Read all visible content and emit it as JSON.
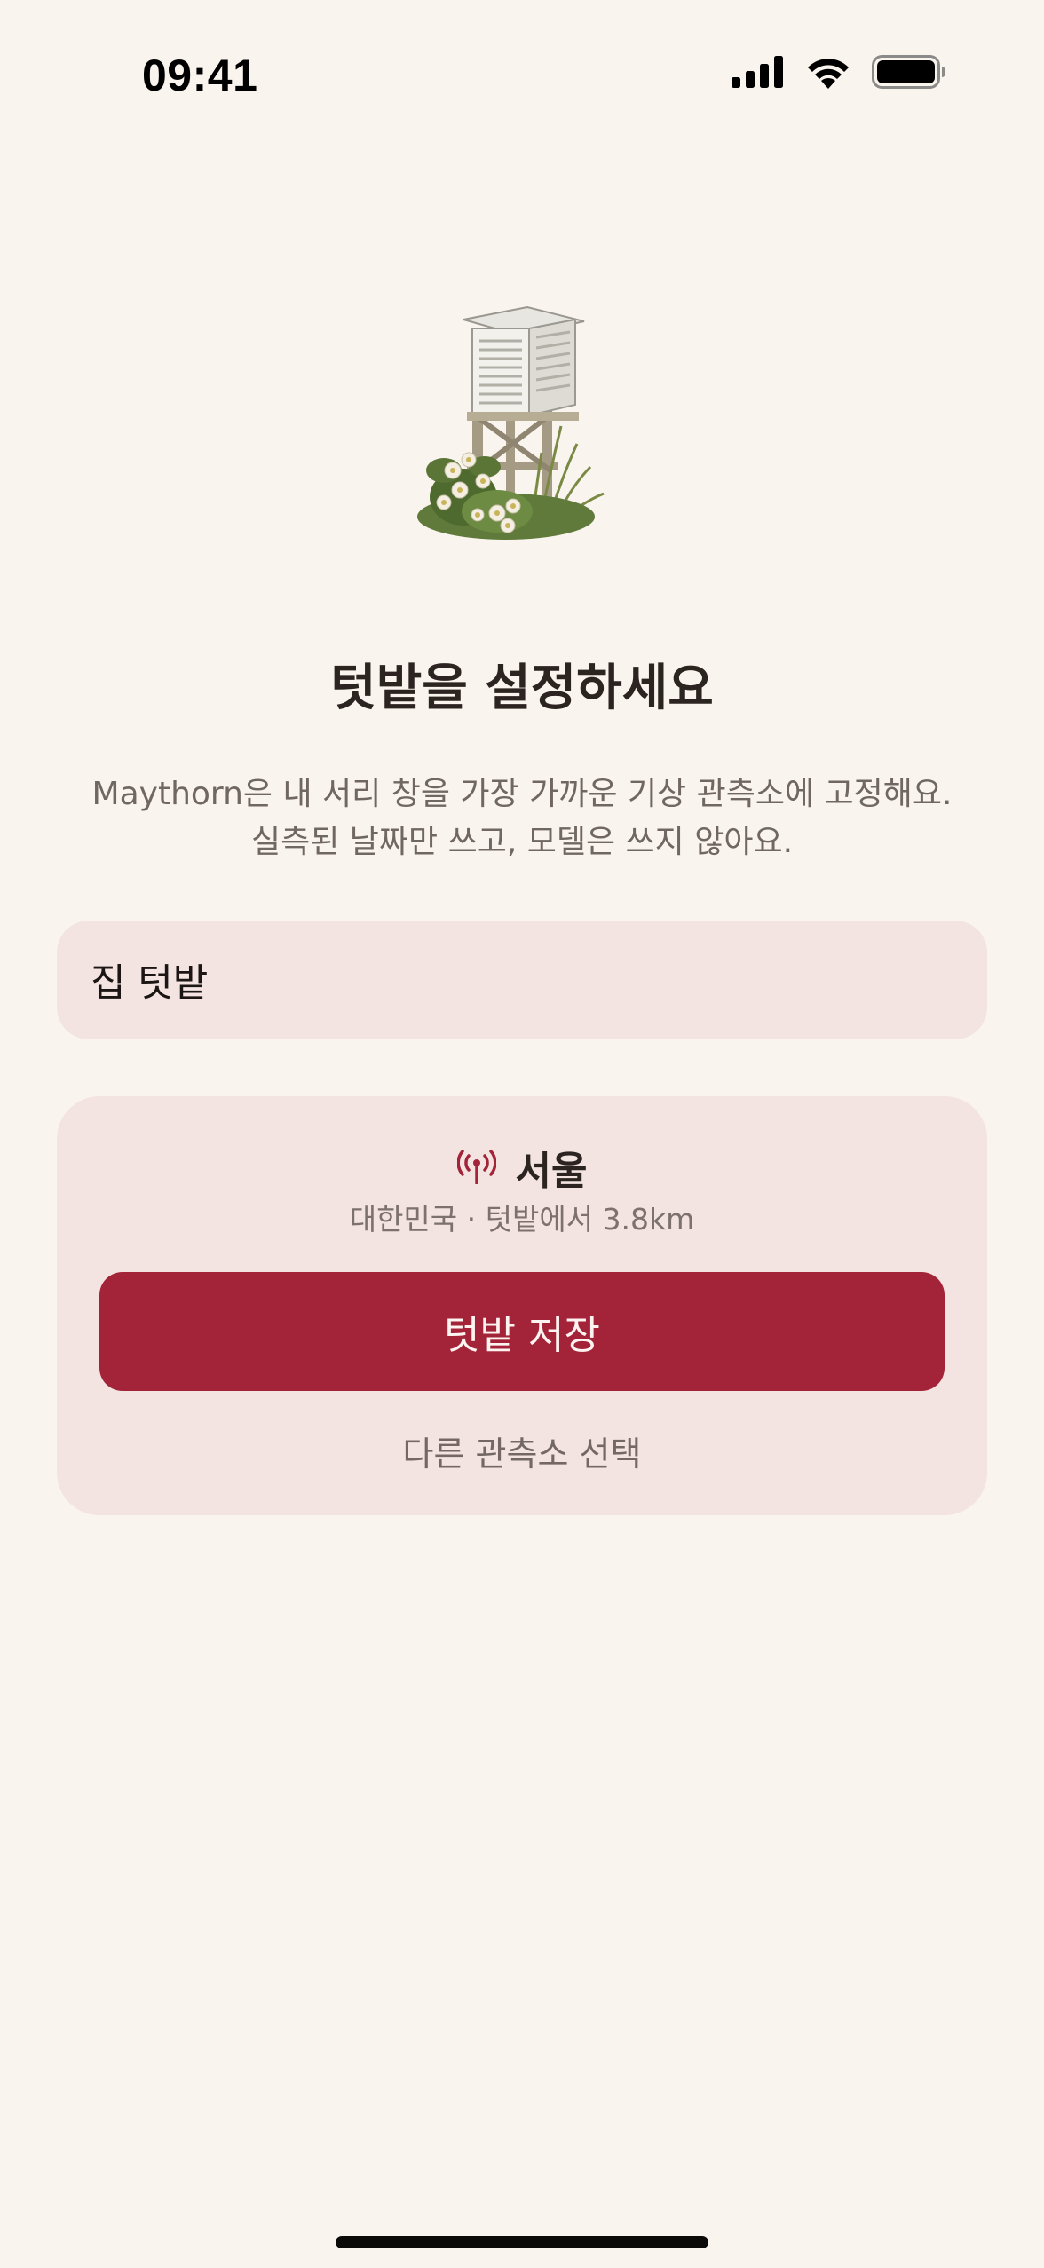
{
  "status_bar": {
    "time": "09:41"
  },
  "illustration": {
    "icon": "weather-station-shelter-illustration"
  },
  "title": "텃밭을 설정하세요",
  "subtitle": {
    "line1": "Maythorn은 내 서리 창을 가장 가까운 기상 관측소에 고정해요.",
    "line2": "실측된 날짜만 쓰고, 모델은 쓰지 않아요."
  },
  "name_field": {
    "value": "집 텃밭"
  },
  "station_card": {
    "icon": "antenna-icon",
    "station_name": "서울",
    "station_meta": "대한민국 · 텃밭에서 3.8km",
    "save_label": "텃밭 저장",
    "other_station_label": "다른 관측소 선택"
  },
  "colors": {
    "background": "#faf4ee",
    "card": "#f3e4e2",
    "accent": "#a32438",
    "muted_text": "#706762"
  }
}
